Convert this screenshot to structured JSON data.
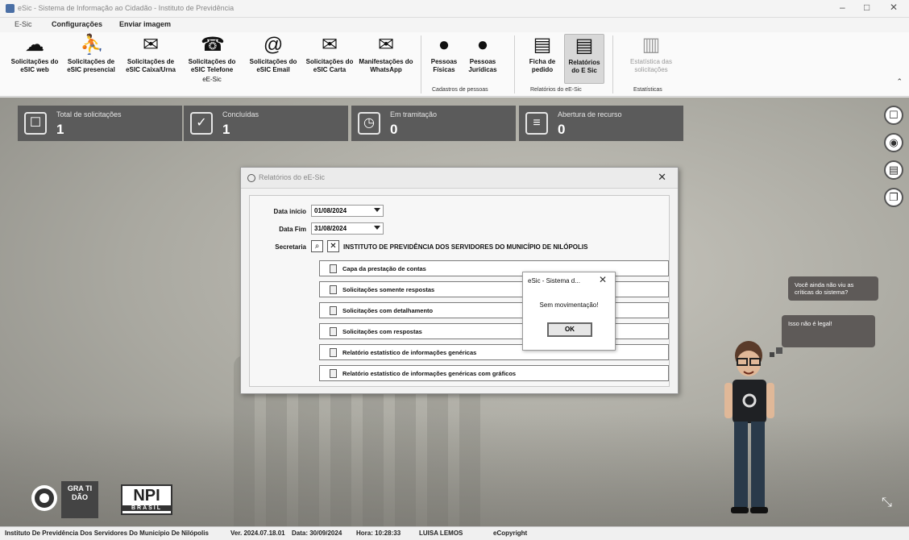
{
  "window": {
    "title": "eSic - Sistema de Informação ao Cidadão - Instituto de Previdência",
    "controls": [
      "–",
      "□",
      "✕"
    ]
  },
  "tabs": [
    "E-Sic",
    "Configurações",
    "Enviar imagem"
  ],
  "ribbon": {
    "buttons": [
      {
        "label": "Solicitações do eSIC web",
        "icon": "cloud-icon"
      },
      {
        "label": "Solicitações de eSIC presencial",
        "icon": "person-desk-icon"
      },
      {
        "label": "Solicitações de eSIC Caixa/Urna",
        "icon": "ballot-box-icon"
      },
      {
        "label": "Solicitações do eSIC Telefone",
        "icon": "headset-icon"
      },
      {
        "label": "Solicitações do eSIC Email",
        "icon": "at-sign-icon"
      },
      {
        "label": "Solicitações do eSIC Carta",
        "icon": "envelope-icon"
      },
      {
        "label": "Manifestações do WhatsApp",
        "icon": "envelope-send-icon"
      },
      {
        "label": "Pessoas Físicas",
        "icon": "person-icon"
      },
      {
        "label": "Pessoas Jurídicas",
        "icon": "person-icon"
      },
      {
        "label": "Ficha de pedido",
        "icon": "form-icon"
      },
      {
        "label": "Relatórios do E Sic",
        "icon": "report-icon"
      },
      {
        "label": "Estatística das solicitações",
        "icon": "stats-icon"
      }
    ],
    "extra_label": "eE-Sic",
    "groups": [
      "Cadastros de pessoas",
      "Relatórios do eE-Sic",
      "Estatísticas"
    ]
  },
  "stats": [
    {
      "label": "Total de solicitações",
      "value": "1"
    },
    {
      "label": "Concluídas",
      "value": "1"
    },
    {
      "label": "Em tramitação",
      "value": "0"
    },
    {
      "label": "Abertura de recurso",
      "value": "0"
    }
  ],
  "dialog": {
    "title": "Relatórios do eE-Sic",
    "date_start_label": "Data início",
    "date_start": "01/08/2024",
    "date_end_label": "Data Fim",
    "date_end": "31/08/2024",
    "secretaria_label": "Secretaria",
    "secretaria": "INSTITUTO DE PREVIDÊNCIA DOS SERVIDORES DO MUNICÍPIO DE NILÓPOLIS",
    "reports": [
      "Capa da prestação de contas",
      "Solicitações somente respostas",
      "Solicitações com detalhamento",
      "Solicitações com respostas",
      "Relatório estatístico de informações genéricas",
      "Relatório estatístico de informações genéricas com gráficos"
    ]
  },
  "message": {
    "title": "eSic - Sistema d...",
    "text": "Sem movimentação!",
    "ok": "OK"
  },
  "bubbles": [
    "Você ainda não viu as críticas do sistema?",
    "Isso não é legal!"
  ],
  "side_buttons": [
    "chat-icon",
    "medal-icon",
    "document-icon",
    "windows-icon"
  ],
  "logos": {
    "brand_a": "GRA TI DÃO",
    "brand_b": "BRASIL",
    "brand_b_mark": "NPI"
  },
  "status": {
    "org": "Instituto De Previdência Dos Servidores Do Município De Nilópolis",
    "version": "Ver. 2024.07.18.01",
    "date": "Data: 30/09/2024",
    "time": "Hora: 10:28:33",
    "user": "LUISA LEMOS",
    "copyright": "eCopyright"
  }
}
